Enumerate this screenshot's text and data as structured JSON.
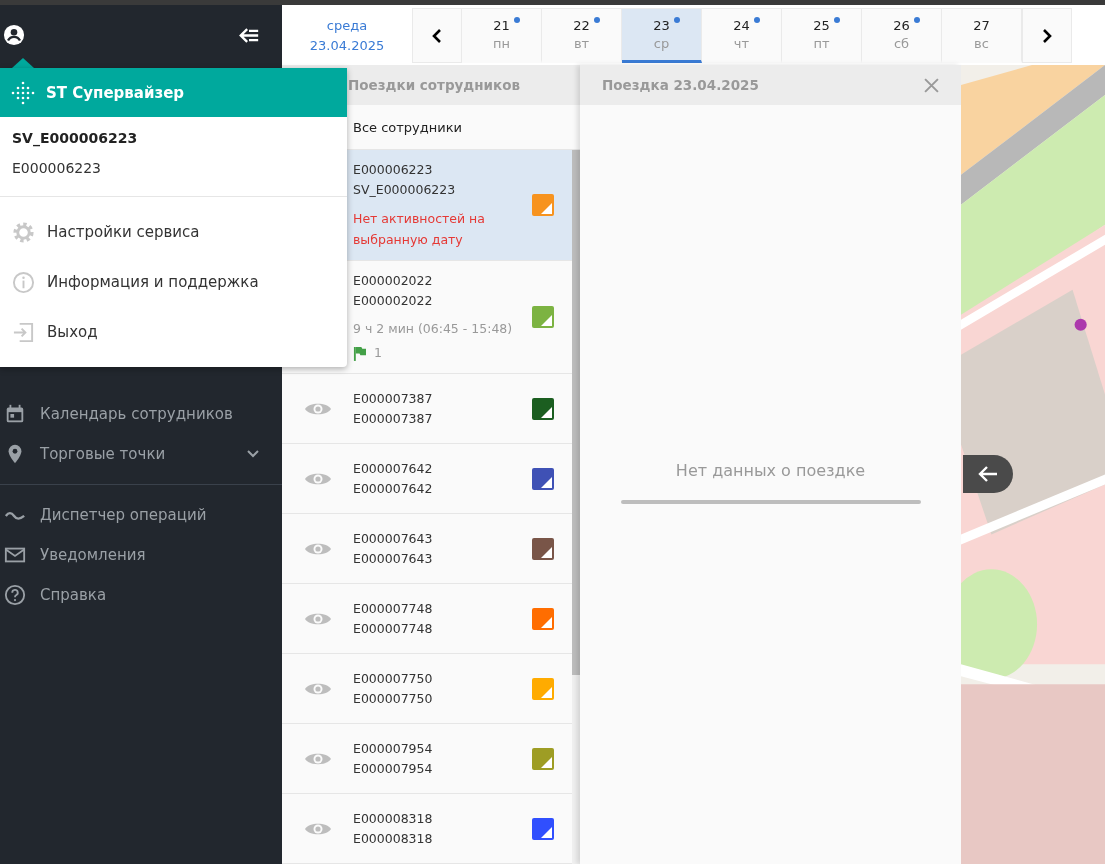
{
  "user_menu": {
    "title": "ST Супервайзер",
    "login": "SV_E000006223",
    "code": "E000006223",
    "items": [
      {
        "label": "Настройки сервиса"
      },
      {
        "label": "Информация и поддержка"
      },
      {
        "label": "Выход"
      }
    ]
  },
  "sidebar": {
    "groups": [
      [
        {
          "label": "Календарь сотрудников",
          "expandable": false
        },
        {
          "label": "Торговые точки",
          "expandable": true
        }
      ],
      [
        {
          "label": "Диспетчер операций",
          "expandable": false
        },
        {
          "label": "Уведомления",
          "expandable": false
        },
        {
          "label": "Справка",
          "expandable": false
        }
      ]
    ]
  },
  "date_picker": {
    "weekday": "среда",
    "date": "23.04.2025",
    "days": [
      {
        "day": "21",
        "weekday": "пн",
        "has_events": true,
        "selected": false
      },
      {
        "day": "22",
        "weekday": "вт",
        "has_events": true,
        "selected": false
      },
      {
        "day": "23",
        "weekday": "ср",
        "has_events": true,
        "selected": true
      },
      {
        "day": "24",
        "weekday": "чт",
        "has_events": true,
        "selected": false
      },
      {
        "day": "25",
        "weekday": "пт",
        "has_events": true,
        "selected": false
      },
      {
        "day": "26",
        "weekday": "сб",
        "has_events": true,
        "selected": false
      },
      {
        "day": "27",
        "weekday": "вс",
        "has_events": false,
        "selected": false
      }
    ]
  },
  "employees": {
    "title": "Поездки сотрудников",
    "filter": "Все сотрудники",
    "rows": [
      {
        "kind": "note",
        "id": "E000006223",
        "login": "SV_E000006223",
        "note": "Нет активностей на выбранную дату",
        "color": "#f7931e",
        "selected": true
      },
      {
        "kind": "trip",
        "id": "E000002022",
        "login": "E000002022",
        "duration": "9 ч 2 мин (06:45 - 15:48)",
        "flags": "1",
        "color": "#7cb342",
        "selected": false
      },
      {
        "kind": "plain",
        "id": "E000007387",
        "login": "E000007387",
        "color": "#1b5e20",
        "selected": false
      },
      {
        "kind": "plain",
        "id": "E000007642",
        "login": "E000007642",
        "color": "#3f51b5",
        "selected": false
      },
      {
        "kind": "plain",
        "id": "E000007643",
        "login": "E000007643",
        "color": "#795548",
        "selected": false
      },
      {
        "kind": "plain",
        "id": "E000007748",
        "login": "E000007748",
        "color": "#ff6d00",
        "selected": false
      },
      {
        "kind": "plain",
        "id": "E000007750",
        "login": "E000007750",
        "color": "#ffab00",
        "selected": false
      },
      {
        "kind": "plain",
        "id": "E000007954",
        "login": "E000007954",
        "color": "#9e9d24",
        "selected": false
      },
      {
        "kind": "plain",
        "id": "E000008318",
        "login": "E000008318",
        "color": "#304ffe",
        "selected": false
      }
    ]
  },
  "trip": {
    "title": "Поездка 23.04.2025",
    "empty_text": "Нет данных о поездке"
  }
}
